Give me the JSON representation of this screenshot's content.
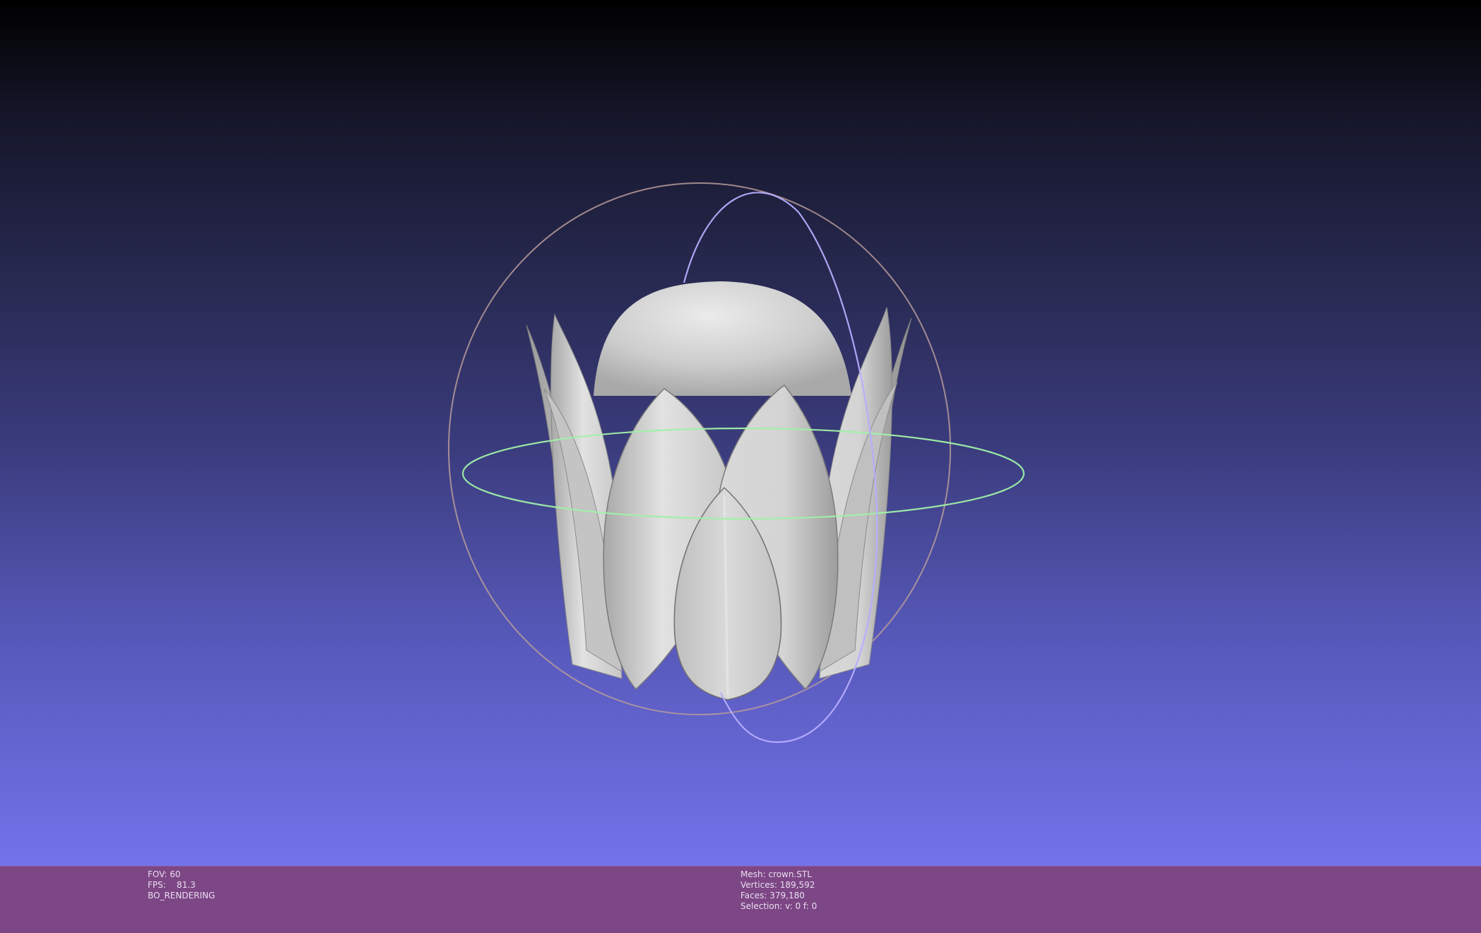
{
  "render_info": {
    "fov": "FOV: 60",
    "fps": "FPS:    81.3",
    "mode": "BO_RENDERING"
  },
  "mesh_info": {
    "mesh": "Mesh: crown.STL",
    "vertices": "Vertices: 189,592",
    "faces": "Faces: 379,180",
    "selection": "Selection: v: 0 f: 0"
  },
  "colors": {
    "status_bar": "#7d4685",
    "gradient_top": "#000000",
    "gradient_bottom": "#7472ea",
    "mesh": "#d0d0d0",
    "trackball_x": "#e8a0a0",
    "trackball_y": "#b0a0ff",
    "trackball_z": "#90f090"
  },
  "icons": {
    "trackball": "trackball-gizmo",
    "model": "crown-mesh"
  }
}
